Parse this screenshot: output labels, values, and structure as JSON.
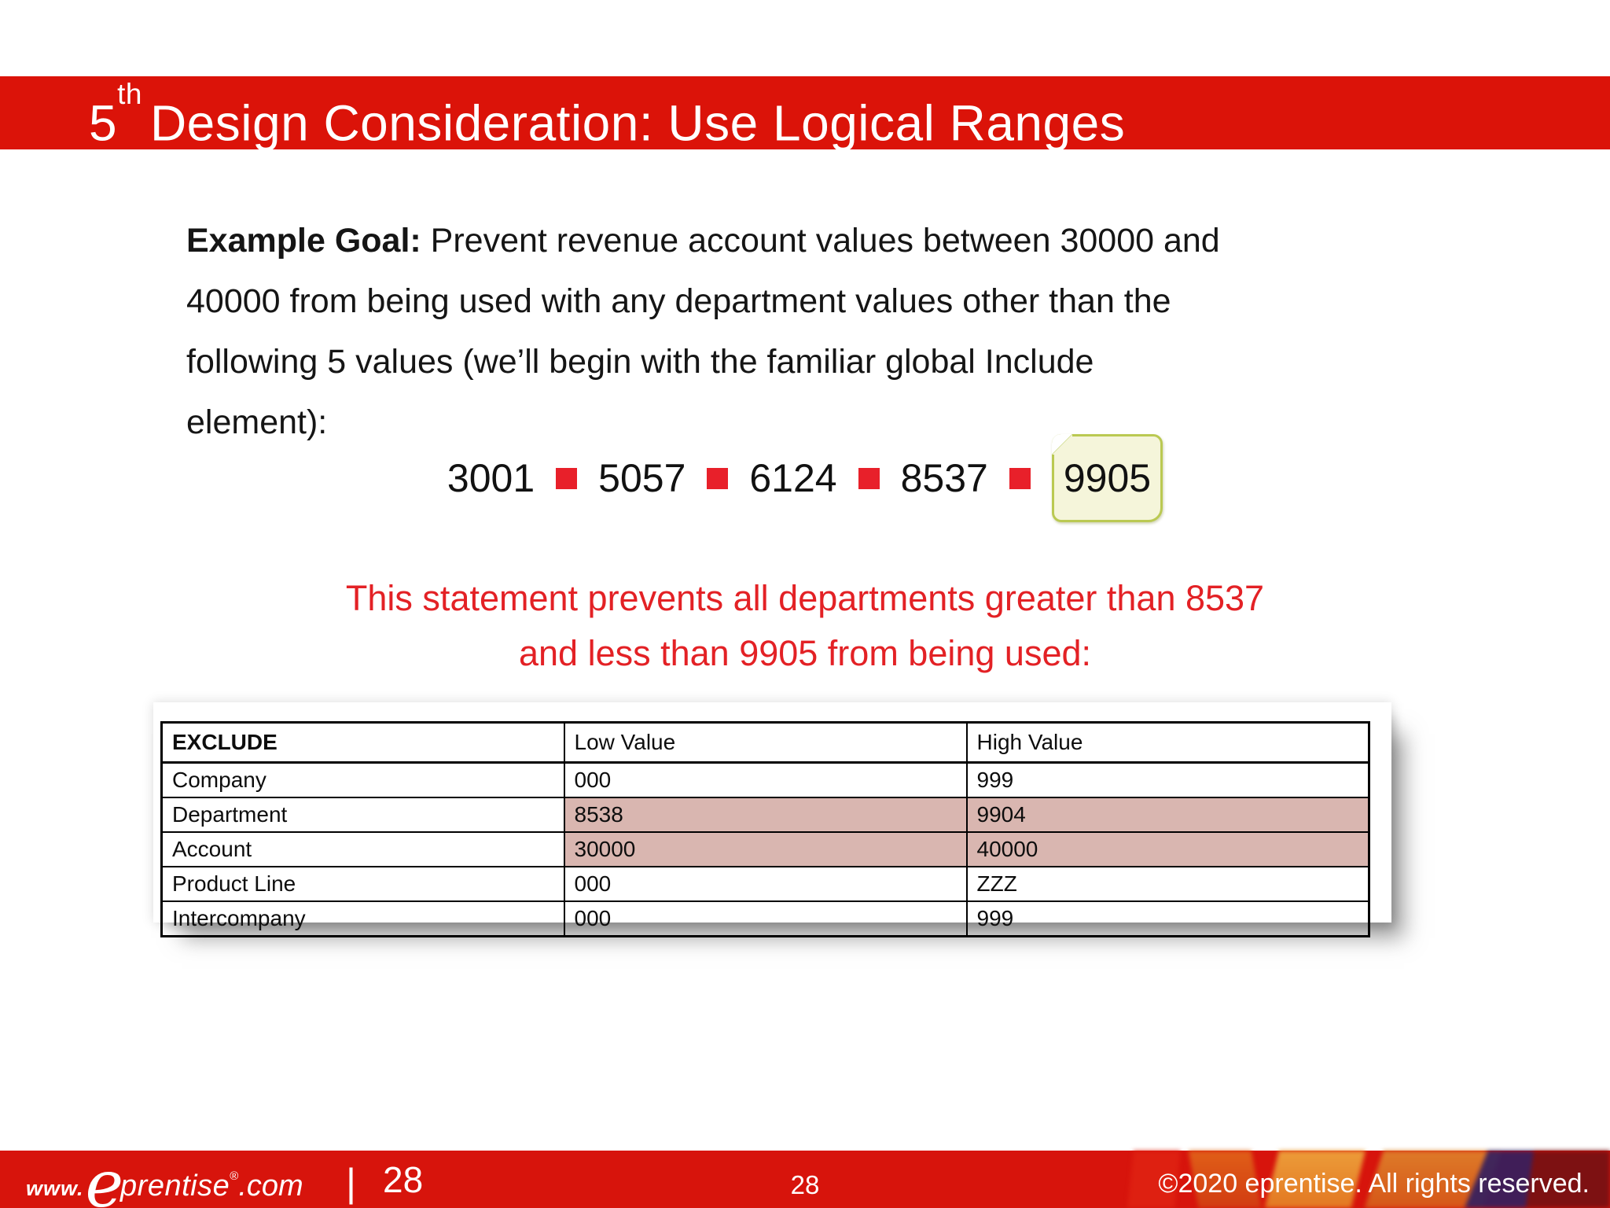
{
  "slide": {
    "title": {
      "number": "5",
      "ordinal": "th",
      "rest": "Design Consideration: Use Logical Ranges"
    },
    "goal": {
      "label": "Example Goal:",
      "text": " Prevent revenue account values between 30000 and 40000 from being used with any department values other than the following 5 values (we’ll begin with the familiar global Include element):"
    },
    "values": {
      "items": [
        "3001",
        "5057",
        "6124",
        "8537",
        "9905"
      ],
      "highlighted_value": "9905",
      "bullet_icon": "red-square"
    },
    "statement": {
      "line1": "This statement prevents all departments greater than 8537",
      "line2": "and less than 9905 from being used:"
    },
    "table": {
      "headers": [
        "EXCLUDE",
        "Low Value",
        "High Value"
      ],
      "rows": [
        {
          "label": "Company",
          "low": "000",
          "high": "999"
        },
        {
          "label": "Department",
          "low": "8538",
          "high": "9904"
        },
        {
          "label": "Account",
          "low": "30000",
          "high": "40000"
        },
        {
          "label": "Product Line",
          "low": "000",
          "high": "ZZZ"
        },
        {
          "label": "Intercompany",
          "low": "000",
          "high": "999"
        }
      ],
      "highlighted_rows": [
        "Department",
        "Account"
      ]
    },
    "footer": {
      "logo": {
        "www": "www.",
        "e": "e",
        "name": "prentise",
        "reg": "®",
        "dotcom": ".com"
      },
      "divider": "|",
      "page_left": "28",
      "page_center": "28",
      "copyright": "©2020 eprentise. All rights reserved."
    },
    "colors": {
      "banner_red": "#db1309",
      "footer_red": "#d7140c",
      "accent_red": "#e32125",
      "bullet_red": "#e8202a",
      "row_highlight_pink": "#d9b6b0",
      "note_fill": "#f5f5da",
      "note_border": "#bac952"
    }
  }
}
